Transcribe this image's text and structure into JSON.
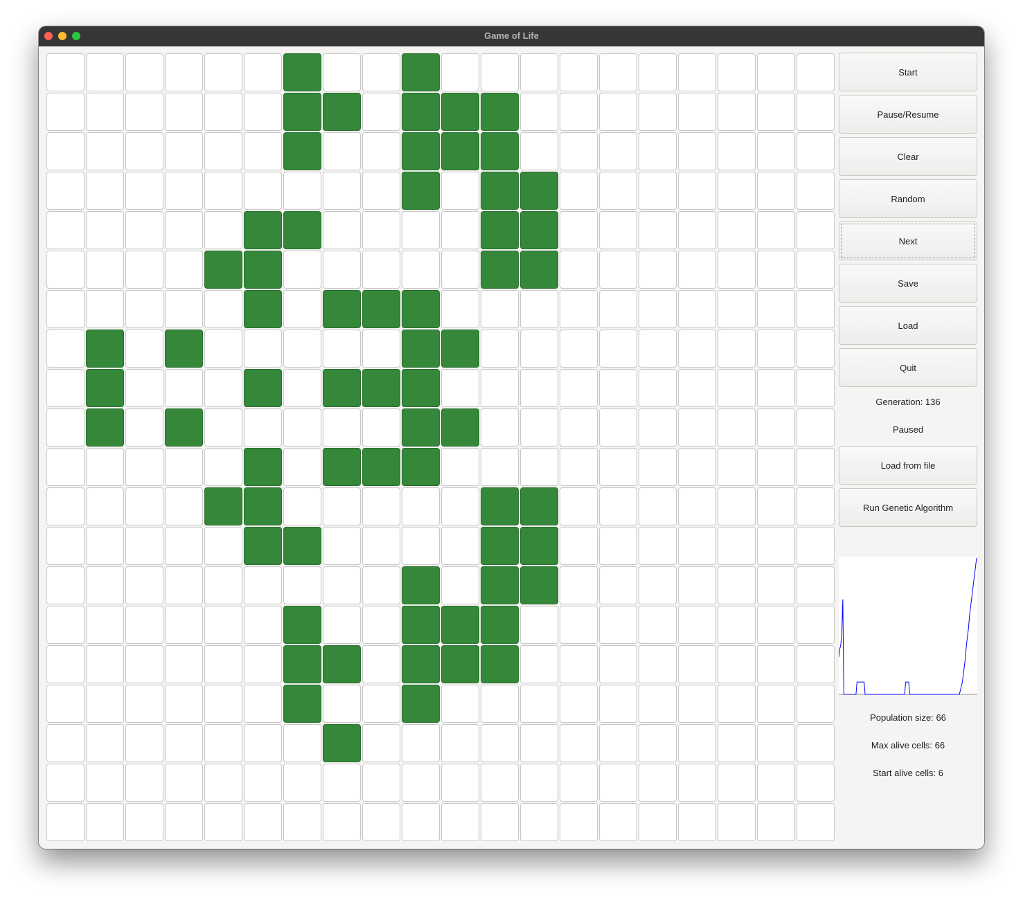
{
  "window": {
    "title": "Game of Life"
  },
  "grid": {
    "rows": 20,
    "cols": 20,
    "alive_color": "#358739",
    "dead_color": "#ffffff",
    "alive": [
      [
        0,
        6
      ],
      [
        0,
        9
      ],
      [
        1,
        6
      ],
      [
        1,
        7
      ],
      [
        1,
        9
      ],
      [
        1,
        10
      ],
      [
        1,
        11
      ],
      [
        2,
        6
      ],
      [
        2,
        9
      ],
      [
        2,
        10
      ],
      [
        2,
        11
      ],
      [
        3,
        9
      ],
      [
        3,
        11
      ],
      [
        3,
        12
      ],
      [
        4,
        5
      ],
      [
        4,
        6
      ],
      [
        4,
        11
      ],
      [
        4,
        12
      ],
      [
        5,
        4
      ],
      [
        5,
        5
      ],
      [
        5,
        11
      ],
      [
        5,
        12
      ],
      [
        6,
        5
      ],
      [
        6,
        7
      ],
      [
        6,
        8
      ],
      [
        6,
        9
      ],
      [
        7,
        1
      ],
      [
        7,
        3
      ],
      [
        7,
        9
      ],
      [
        7,
        10
      ],
      [
        8,
        1
      ],
      [
        8,
        5
      ],
      [
        8,
        7
      ],
      [
        8,
        8
      ],
      [
        8,
        9
      ],
      [
        9,
        1
      ],
      [
        9,
        3
      ],
      [
        9,
        9
      ],
      [
        9,
        10
      ],
      [
        10,
        5
      ],
      [
        10,
        7
      ],
      [
        10,
        8
      ],
      [
        10,
        9
      ],
      [
        11,
        4
      ],
      [
        11,
        5
      ],
      [
        11,
        11
      ],
      [
        11,
        12
      ],
      [
        12,
        5
      ],
      [
        12,
        6
      ],
      [
        12,
        11
      ],
      [
        12,
        12
      ],
      [
        13,
        9
      ],
      [
        13,
        11
      ],
      [
        13,
        12
      ],
      [
        14,
        6
      ],
      [
        14,
        9
      ],
      [
        14,
        10
      ],
      [
        14,
        11
      ],
      [
        15,
        6
      ],
      [
        15,
        7
      ],
      [
        15,
        9
      ],
      [
        15,
        10
      ],
      [
        15,
        11
      ],
      [
        16,
        6
      ],
      [
        16,
        9
      ],
      [
        17,
        7
      ]
    ]
  },
  "controls": {
    "start": "Start",
    "pause_resume": "Pause/Resume",
    "clear": "Clear",
    "random": "Random",
    "next": "Next",
    "save": "Save",
    "load": "Load",
    "quit": "Quit",
    "load_from_file": "Load from file",
    "run_genetic": "Run Genetic Algorithm"
  },
  "status": {
    "generation": "Generation: 136",
    "state": "Paused"
  },
  "stats": {
    "population": "Population size: 66",
    "max_alive": "Max alive cells: 66",
    "start_alive": "Start alive cells: 6"
  },
  "chart_data": {
    "type": "line",
    "line_color": "#0000ff",
    "background": "#ffffff",
    "x": [
      0,
      1,
      2,
      3,
      4,
      5,
      6,
      7,
      8,
      9,
      10,
      11,
      12,
      13,
      14,
      15,
      16,
      17,
      18,
      19,
      20,
      21,
      22,
      23,
      24,
      25,
      26,
      27,
      28,
      29,
      30,
      31,
      32,
      33,
      34,
      35,
      36,
      37,
      38,
      39,
      40,
      41,
      42,
      43,
      44,
      45,
      46,
      47,
      48,
      49,
      50,
      51,
      52,
      53,
      54,
      55,
      56,
      57,
      58,
      59,
      60,
      61,
      62,
      63,
      64,
      65,
      66,
      67,
      68,
      69,
      70,
      71,
      72,
      73,
      74,
      75,
      76,
      77,
      78,
      79,
      80,
      81,
      82,
      83,
      84,
      85,
      86,
      87,
      88,
      89,
      90,
      91,
      92,
      93,
      94,
      95,
      96,
      97,
      98,
      99,
      100,
      101,
      102,
      103,
      104,
      105,
      106,
      107,
      108,
      109,
      110,
      111,
      112,
      113,
      114,
      115,
      116,
      117,
      118,
      119,
      120,
      121,
      122,
      123,
      124,
      125,
      126,
      127,
      128,
      129,
      130,
      131,
      132,
      133,
      134,
      135,
      136
    ],
    "y": [
      18,
      22,
      24,
      30,
      46,
      0,
      0,
      0,
      0,
      0,
      0,
      0,
      0,
      0,
      0,
      0,
      0,
      0,
      6,
      6,
      6,
      6,
      6,
      6,
      6,
      6,
      0,
      0,
      0,
      0,
      0,
      0,
      0,
      0,
      0,
      0,
      0,
      0,
      0,
      0,
      0,
      0,
      0,
      0,
      0,
      0,
      0,
      0,
      0,
      0,
      0,
      0,
      0,
      0,
      0,
      0,
      0,
      0,
      0,
      0,
      0,
      0,
      0,
      0,
      0,
      0,
      6,
      6,
      6,
      6,
      0,
      0,
      0,
      0,
      0,
      0,
      0,
      0,
      0,
      0,
      0,
      0,
      0,
      0,
      0,
      0,
      0,
      0,
      0,
      0,
      0,
      0,
      0,
      0,
      0,
      0,
      0,
      0,
      0,
      0,
      0,
      0,
      0,
      0,
      0,
      0,
      0,
      0,
      0,
      0,
      0,
      0,
      0,
      0,
      0,
      0,
      0,
      0,
      0,
      0,
      2,
      4,
      6,
      10,
      14,
      18,
      24,
      28,
      32,
      38,
      42,
      46,
      50,
      54,
      58,
      62,
      66
    ],
    "ylim": [
      0,
      66
    ]
  }
}
